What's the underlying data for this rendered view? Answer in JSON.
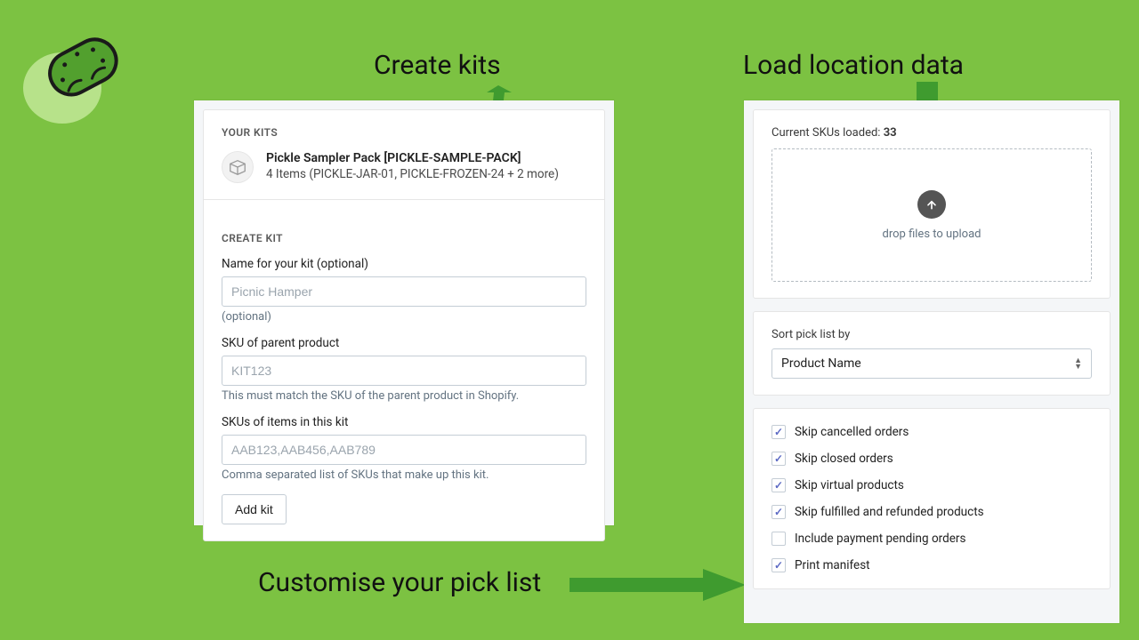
{
  "callouts": {
    "create": "Create kits",
    "load": "Load location data",
    "customise": "Customise your pick list"
  },
  "left": {
    "your_kits_title": "YOUR KITS",
    "kit": {
      "name": "Pickle Sampler Pack [PICKLE-SAMPLE-PACK]",
      "items_line": "4 Items (PICKLE-JAR-01, PICKLE-FROZEN-24 + 2 more)"
    },
    "create_kit_title": "CREATE KIT",
    "name_label": "Name for your kit (optional)",
    "name_placeholder": "Picnic Hamper",
    "name_help": "(optional)",
    "sku_label": "SKU of parent product",
    "sku_placeholder": "KIT123",
    "sku_help": "This must match the SKU of the parent product in Shopify.",
    "items_label": "SKUs of items in this kit",
    "items_placeholder": "AAB123,AAB456,AAB789",
    "items_help": "Comma separated list of SKUs that make up this kit.",
    "add_button": "Add kit"
  },
  "right": {
    "sku_count_label": "Current SKUs loaded: ",
    "sku_count_value": "33",
    "dropzone_text": "drop files to upload",
    "sort_label": "Sort pick list by",
    "sort_value": "Product Name",
    "opts": [
      {
        "label": "Skip cancelled orders",
        "checked": true
      },
      {
        "label": "Skip closed orders",
        "checked": true
      },
      {
        "label": "Skip virtual products",
        "checked": true
      },
      {
        "label": "Skip fulfilled and refunded products",
        "checked": true
      },
      {
        "label": "Include payment pending orders",
        "checked": false
      },
      {
        "label": "Print manifest",
        "checked": true
      }
    ]
  }
}
